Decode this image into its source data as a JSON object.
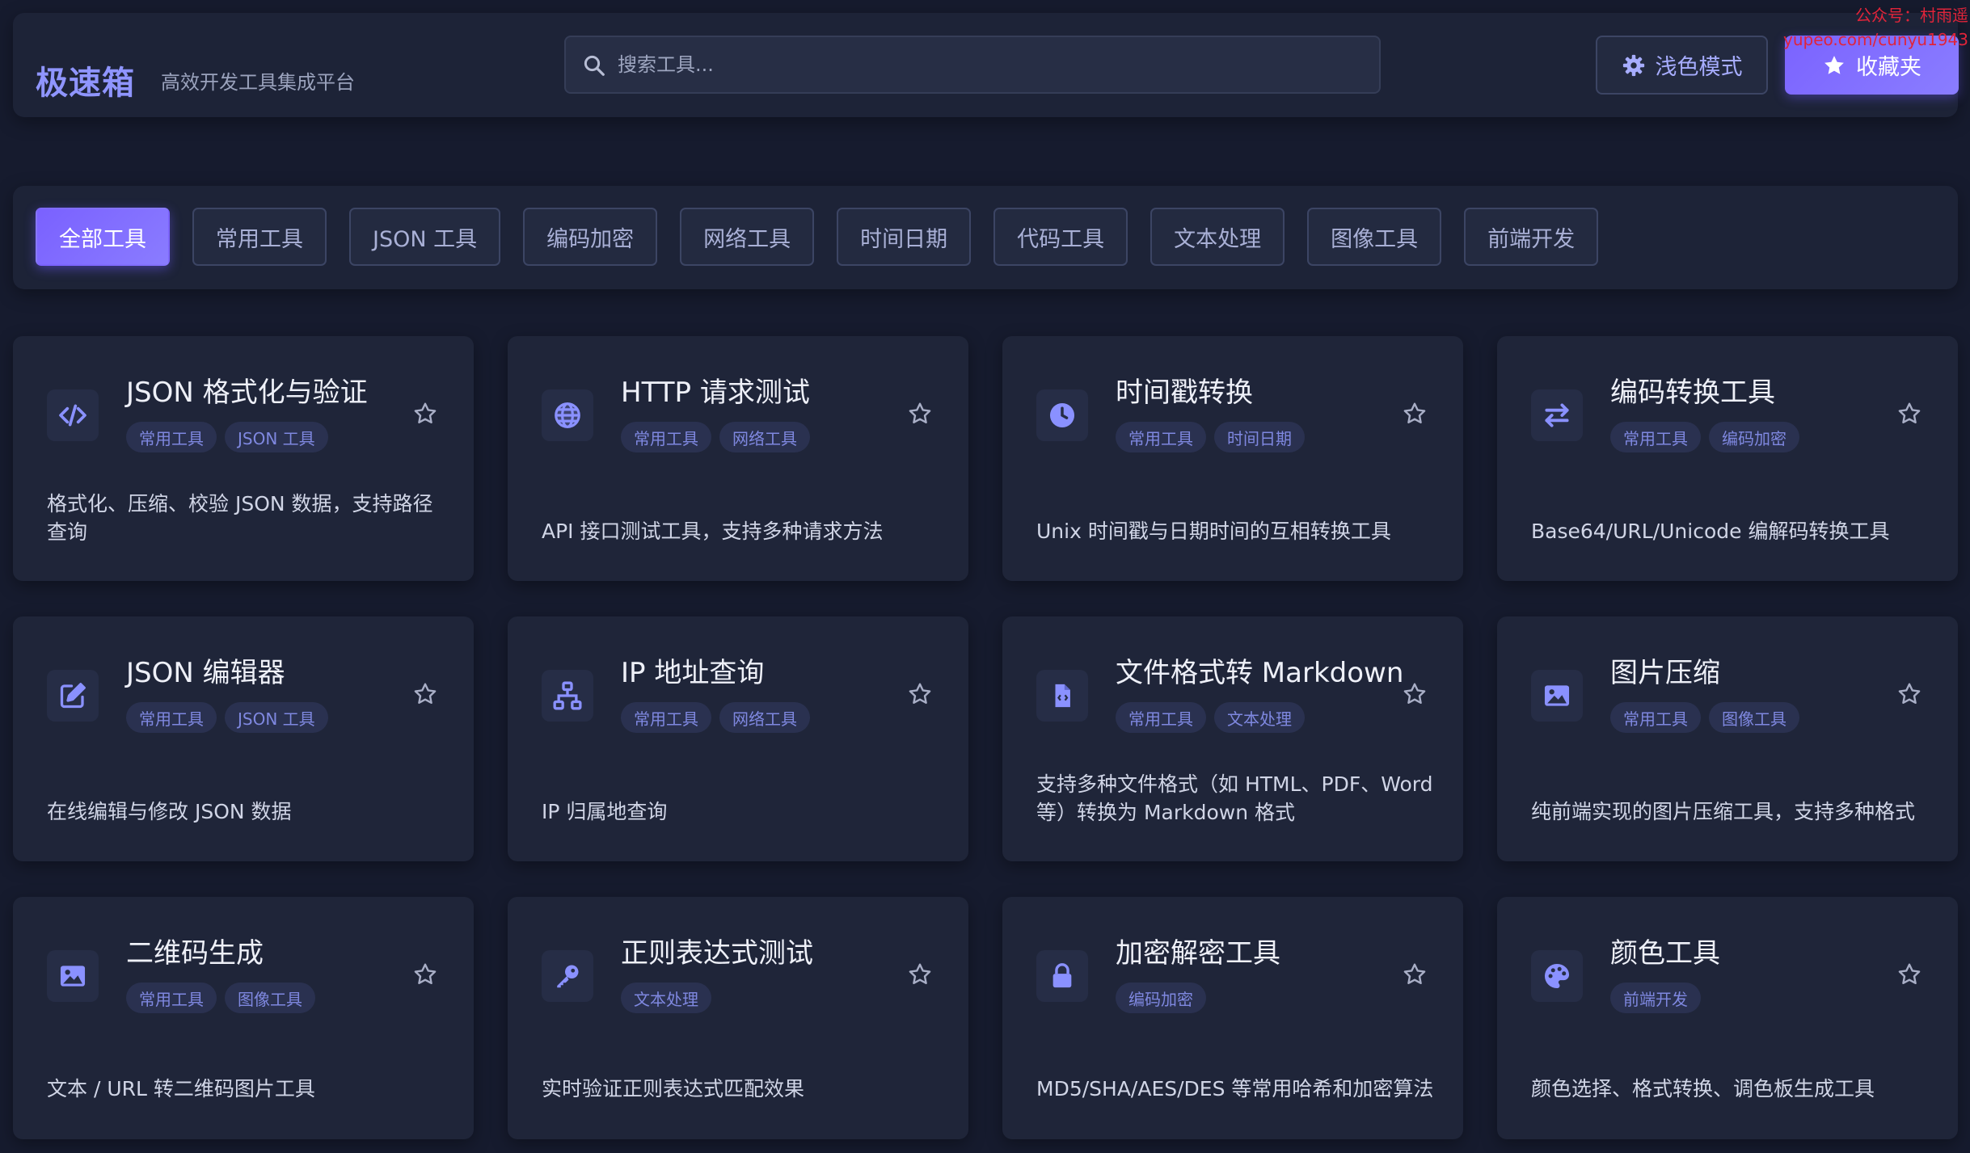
{
  "header": {
    "logo": "极速箱",
    "subtitle": "高效开发工具集成平台",
    "search_placeholder": "搜索工具...",
    "theme_button": "浅色模式",
    "favorites_button": "收藏夹",
    "watermark_line1": "公众号：村雨遥",
    "watermark_line2": "yupeo.com/cunyu1943"
  },
  "categories": [
    "全部工具",
    "常用工具",
    "JSON 工具",
    "编码加密",
    "网络工具",
    "时间日期",
    "代码工具",
    "文本处理",
    "图像工具",
    "前端开发"
  ],
  "active_category": "全部工具",
  "tools": [
    {
      "title": "JSON 格式化与验证",
      "tags": [
        "常用工具",
        "JSON 工具"
      ],
      "desc": "格式化、压缩、校验 JSON 数据，支持路径查询",
      "icon": "code-icon"
    },
    {
      "title": "HTTP 请求测试",
      "tags": [
        "常用工具",
        "网络工具"
      ],
      "desc": "API 接口测试工具，支持多种请求方法",
      "icon": "globe-icon"
    },
    {
      "title": "时间戳转换",
      "tags": [
        "常用工具",
        "时间日期"
      ],
      "desc": "Unix 时间戳与日期时间的互相转换工具",
      "icon": "clock-icon"
    },
    {
      "title": "编码转换工具",
      "tags": [
        "常用工具",
        "编码加密"
      ],
      "desc": "Base64/URL/Unicode 编解码转换工具",
      "icon": "exchange-icon"
    },
    {
      "title": "JSON 编辑器",
      "tags": [
        "常用工具",
        "JSON 工具"
      ],
      "desc": "在线编辑与修改 JSON 数据",
      "icon": "edit-icon"
    },
    {
      "title": "IP 地址查询",
      "tags": [
        "常用工具",
        "网络工具"
      ],
      "desc": "IP 归属地查询",
      "icon": "network-icon"
    },
    {
      "title": "文件格式转 Markdown",
      "tags": [
        "常用工具",
        "文本处理"
      ],
      "desc": "支持多种文件格式（如 HTML、PDF、Word 等）转换为 Markdown 格式",
      "icon": "file-code-icon"
    },
    {
      "title": "图片压缩",
      "tags": [
        "常用工具",
        "图像工具"
      ],
      "desc": "纯前端实现的图片压缩工具，支持多种格式",
      "icon": "image-icon"
    },
    {
      "title": "二维码生成",
      "tags": [
        "常用工具",
        "图像工具"
      ],
      "desc": "文本 / URL 转二维码图片工具",
      "icon": "image-icon"
    },
    {
      "title": "正则表达式测试",
      "tags": [
        "文本处理"
      ],
      "desc": "实时验证正则表达式匹配效果",
      "icon": "key-icon"
    },
    {
      "title": "加密解密工具",
      "tags": [
        "编码加密"
      ],
      "desc": "MD5/SHA/AES/DES 等常用哈希和加密算法",
      "icon": "lock-icon"
    },
    {
      "title": "颜色工具",
      "tags": [
        "前端开发"
      ],
      "desc": "颜色选择、格式转换、调色板生成工具",
      "icon": "palette-icon"
    }
  ],
  "colors": {
    "accent": "#7b63ff",
    "background": "#161b2e",
    "card": "#1f2539",
    "tag_text": "#7f88e0"
  }
}
